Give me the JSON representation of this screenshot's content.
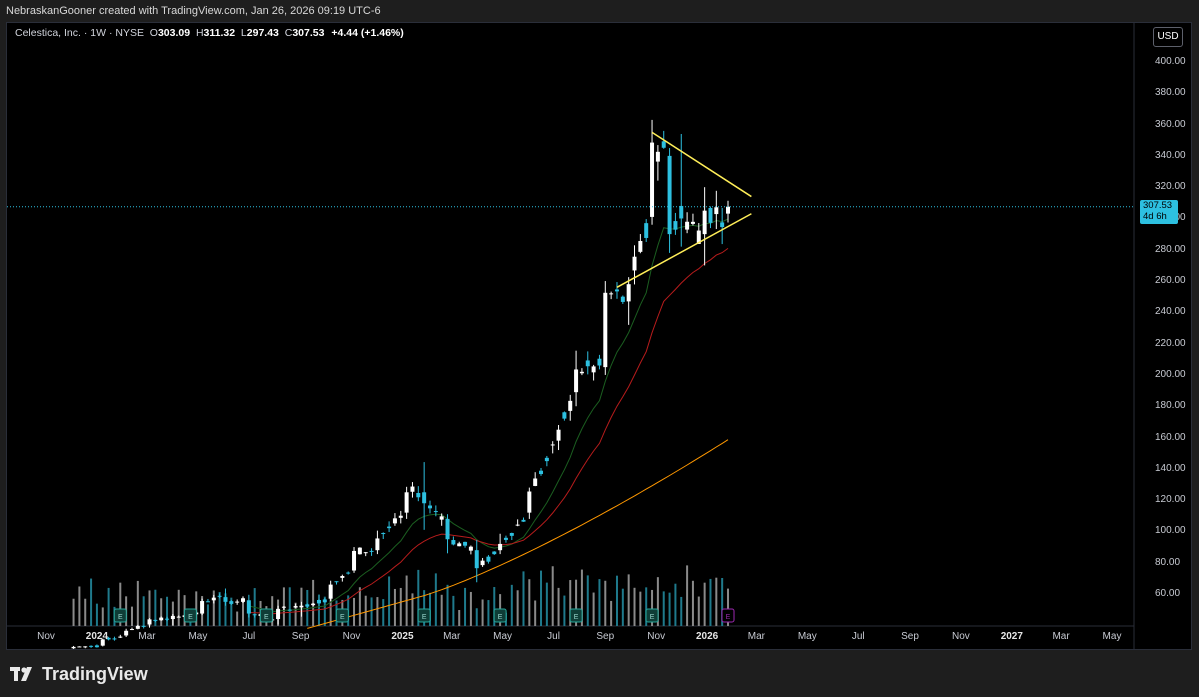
{
  "header": {
    "credit": "NebraskanGooner created with TradingView.com, Jan 26, 2026 09:19 UTC-6"
  },
  "legend": {
    "symbol": "Celestica, Inc. · 1W · NYSE",
    "o_label": "O",
    "o_value": "303.09",
    "h_label": "H",
    "h_value": "311.32",
    "l_label": "L",
    "l_value": "297.43",
    "c_label": "C",
    "c_value": "307.53",
    "change": "+4.44 (+1.46%)"
  },
  "currency_button": "USD",
  "price_axis": [
    "400.00",
    "380.00",
    "360.00",
    "340.00",
    "320.00",
    "300.00",
    "280.00",
    "260.00",
    "240.00",
    "220.00",
    "200.00",
    "180.00",
    "160.00",
    "140.00",
    "120.00",
    "100.00",
    "80.00",
    "60.00"
  ],
  "last_price": {
    "price": "307.53",
    "countdown": "4d 6h"
  },
  "time_axis": [
    {
      "label": "Nov"
    },
    {
      "label": "2024",
      "bold": true
    },
    {
      "label": "Mar"
    },
    {
      "label": "May"
    },
    {
      "label": "Jul"
    },
    {
      "label": "Sep"
    },
    {
      "label": "Nov"
    },
    {
      "label": "2025",
      "bold": true
    },
    {
      "label": "Mar"
    },
    {
      "label": "May"
    },
    {
      "label": "Jul"
    },
    {
      "label": "Sep"
    },
    {
      "label": "Nov"
    },
    {
      "label": "2026",
      "bold": true
    },
    {
      "label": "Mar"
    },
    {
      "label": "May"
    },
    {
      "label": "Jul"
    },
    {
      "label": "Sep"
    },
    {
      "label": "Nov"
    },
    {
      "label": "2027",
      "bold": true
    },
    {
      "label": "Mar"
    },
    {
      "label": "May"
    }
  ],
  "footer": {
    "brand": "TradingView"
  },
  "earnings_marker": "E",
  "colors": {
    "up": "#ffffff",
    "down": "#2dc0e0",
    "triangle": "#ffee58",
    "ema_short": "#1b5e20",
    "ema_long": "#b71c1c",
    "sma_200": "#ff9800",
    "price_line": "#2dc0e0",
    "earnings_past": "#26a69a",
    "earnings_future": "#9c27b0"
  },
  "chart_data": {
    "type": "candlestick",
    "symbol": "Celestica, Inc.",
    "interval": "1W",
    "exchange": "NYSE",
    "currency": "USD",
    "ylim": [
      50,
      410
    ],
    "last": 307.53,
    "candles": [
      {
        "date": "2023-12-04",
        "o": 25.3,
        "h": 26.8,
        "l": 24.9,
        "c": 26.2
      },
      {
        "date": "2024-01-08",
        "o": 27.0,
        "h": 31.5,
        "l": 26.5,
        "c": 31.0
      },
      {
        "date": "2024-02-05",
        "o": 33.5,
        "h": 37.8,
        "l": 32.5,
        "c": 36.5
      },
      {
        "date": "2024-03-04",
        "o": 40.5,
        "h": 44.6,
        "l": 38.5,
        "c": 43.8
      },
      {
        "date": "2024-04-01",
        "o": 44.0,
        "h": 47.2,
        "l": 40.0,
        "c": 46.0
      },
      {
        "date": "2024-05-06",
        "o": 47.5,
        "h": 57.0,
        "l": 46.5,
        "c": 55.5
      },
      {
        "date": "2024-06-03",
        "o": 58.0,
        "h": 63.5,
        "l": 52.5,
        "c": 55.0
      },
      {
        "date": "2024-07-01",
        "o": 56.0,
        "h": 59.5,
        "l": 45.0,
        "c": 47.5
      },
      {
        "date": "2024-08-05",
        "o": 44.0,
        "h": 52.5,
        "l": 40.5,
        "c": 50.5
      },
      {
        "date": "2024-09-02",
        "o": 51.5,
        "h": 55.0,
        "l": 45.5,
        "c": 52.5
      },
      {
        "date": "2024-10-07",
        "o": 57.0,
        "h": 68.5,
        "l": 55.5,
        "c": 66.0
      },
      {
        "date": "2024-11-04",
        "o": 75.0,
        "h": 90.0,
        "l": 73.5,
        "c": 87.5
      },
      {
        "date": "2024-12-02",
        "o": 88.0,
        "h": 100.5,
        "l": 85.5,
        "c": 95.5
      },
      {
        "date": "2025-01-06",
        "o": 112.0,
        "h": 128.5,
        "l": 108.0,
        "c": 125.0
      },
      {
        "date": "2025-01-27",
        "o": 125.0,
        "h": 144.3,
        "l": 101.0,
        "c": 118.0
      },
      {
        "date": "2025-02-24",
        "o": 108.0,
        "h": 111.0,
        "l": 86.0,
        "c": 95.0
      },
      {
        "date": "2025-03-31",
        "o": 88.0,
        "h": 94.5,
        "l": 67.5,
        "c": 76.5
      },
      {
        "date": "2025-04-28",
        "o": 88.0,
        "h": 98.5,
        "l": 85.5,
        "c": 92.0
      },
      {
        "date": "2025-06-02",
        "o": 112.0,
        "h": 128.0,
        "l": 108.0,
        "c": 125.5
      },
      {
        "date": "2025-07-07",
        "o": 158.0,
        "h": 168.0,
        "l": 152.0,
        "c": 165.0
      },
      {
        "date": "2025-07-28",
        "o": 189.0,
        "h": 215.5,
        "l": 180.0,
        "c": 203.5
      },
      {
        "date": "2025-09-01",
        "o": 205.0,
        "h": 260.0,
        "l": 200.0,
        "c": 252.5
      },
      {
        "date": "2025-09-29",
        "o": 247.0,
        "h": 262.5,
        "l": 232.0,
        "c": 258.0
      },
      {
        "date": "2025-10-27",
        "o": 301.0,
        "h": 363.0,
        "l": 296.0,
        "c": 348.5
      },
      {
        "date": "2025-11-17",
        "o": 340.0,
        "h": 345.0,
        "l": 278.0,
        "c": 290.0
      },
      {
        "date": "2025-12-01",
        "o": 308.0,
        "h": 354.0,
        "l": 282.0,
        "c": 300.0
      },
      {
        "date": "2025-12-29",
        "o": 290.0,
        "h": 320.0,
        "l": 270.0,
        "c": 305.0
      },
      {
        "date": "2026-01-26",
        "o": 303.09,
        "h": 311.32,
        "l": 297.43,
        "c": 307.53
      }
    ],
    "indicators": [
      {
        "name": "EMA (short)",
        "color": "#1b5e20"
      },
      {
        "name": "EMA (long)",
        "color": "#b71c1c"
      },
      {
        "name": "SMA 200",
        "color": "#ff9800"
      }
    ],
    "trendlines": [
      {
        "name": "triangle-upper",
        "from": {
          "date": "2025-10-27",
          "price": 355
        },
        "to": {
          "date": "2026-02-23",
          "price": 314
        }
      },
      {
        "name": "triangle-lower",
        "from": {
          "date": "2025-09-15",
          "price": 256
        },
        "to": {
          "date": "2026-02-23",
          "price": 303
        }
      }
    ],
    "earnings_dates": [
      "2024-01-29",
      "2024-04-22",
      "2024-07-22",
      "2024-10-21",
      "2025-01-27",
      "2025-04-28",
      "2025-07-28",
      "2025-10-27",
      "2026-01-26"
    ]
  }
}
